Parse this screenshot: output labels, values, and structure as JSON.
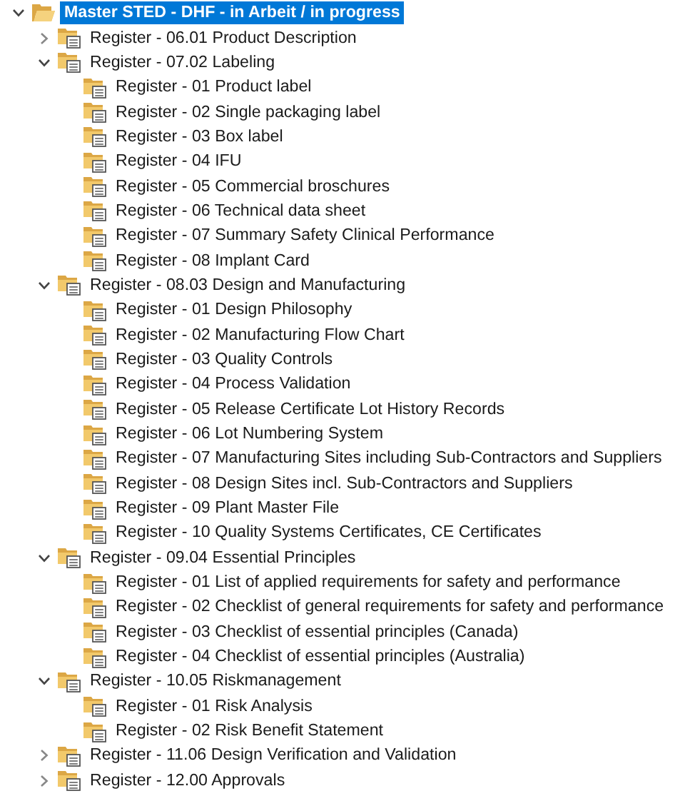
{
  "tree": [
    {
      "label": "Master STED - DHF - in Arbeit / in progress",
      "kind": "folder",
      "selected": true,
      "expanded": true,
      "children": [
        {
          "label": "Register - 06.01 Product Description",
          "kind": "register",
          "selected": false,
          "expanded": false
        },
        {
          "label": "Register - 07.02 Labeling",
          "kind": "register",
          "selected": false,
          "expanded": true,
          "children": [
            {
              "label": "Register - 01 Product label",
              "kind": "register",
              "selected": false
            },
            {
              "label": "Register - 02 Single packaging label",
              "kind": "register",
              "selected": false
            },
            {
              "label": "Register - 03 Box label",
              "kind": "register",
              "selected": false
            },
            {
              "label": "Register - 04 IFU",
              "kind": "register",
              "selected": false
            },
            {
              "label": "Register - 05 Commercial broschures",
              "kind": "register",
              "selected": false
            },
            {
              "label": "Register - 06 Technical data sheet",
              "kind": "register",
              "selected": false
            },
            {
              "label": "Register - 07 Summary Safety Clinical Performance",
              "kind": "register",
              "selected": false
            },
            {
              "label": "Register - 08 Implant Card",
              "kind": "register",
              "selected": false
            }
          ]
        },
        {
          "label": "Register - 08.03 Design and Manufacturing",
          "kind": "register",
          "selected": false,
          "expanded": true,
          "children": [
            {
              "label": "Register - 01 Design Philosophy",
              "kind": "register",
              "selected": false
            },
            {
              "label": "Register - 02 Manufacturing Flow Chart",
              "kind": "register",
              "selected": false
            },
            {
              "label": "Register - 03 Quality Controls",
              "kind": "register",
              "selected": false
            },
            {
              "label": "Register - 04 Process Validation",
              "kind": "register",
              "selected": false
            },
            {
              "label": "Register - 05 Release Certificate Lot History Records",
              "kind": "register",
              "selected": false
            },
            {
              "label": "Register - 06 Lot Numbering System",
              "kind": "register",
              "selected": false
            },
            {
              "label": "Register - 07 Manufacturing Sites including Sub-Contractors and Suppliers",
              "kind": "register",
              "selected": false
            },
            {
              "label": "Register - 08 Design Sites incl. Sub-Contractors and Suppliers",
              "kind": "register",
              "selected": false
            },
            {
              "label": "Register - 09 Plant Master File",
              "kind": "register",
              "selected": false
            },
            {
              "label": "Register - 10 Quality Systems Certificates, CE Certificates",
              "kind": "register",
              "selected": false
            }
          ]
        },
        {
          "label": "Register - 09.04 Essential Principles",
          "kind": "register",
          "selected": false,
          "expanded": true,
          "children": [
            {
              "label": "Register - 01 List of applied requirements for safety and performance",
              "kind": "register",
              "selected": false
            },
            {
              "label": "Register - 02 Checklist of general requirements for safety and performance",
              "kind": "register",
              "selected": false
            },
            {
              "label": "Register - 03 Checklist of essential principles (Canada)",
              "kind": "register",
              "selected": false
            },
            {
              "label": "Register - 04 Checklist of essential principles (Australia)",
              "kind": "register",
              "selected": false
            }
          ]
        },
        {
          "label": "Register - 10.05 Riskmanagement",
          "kind": "register",
          "selected": false,
          "expanded": true,
          "children": [
            {
              "label": "Register - 01 Risk Analysis",
              "kind": "register",
              "selected": false
            },
            {
              "label": "Register - 02 Risk Benefit Statement",
              "kind": "register",
              "selected": false
            }
          ]
        },
        {
          "label": "Register - 11.06 Design Verification and Validation",
          "kind": "register",
          "selected": false,
          "expanded": false
        },
        {
          "label": "Register - 12.00 Approvals",
          "kind": "register",
          "selected": false,
          "expanded": false
        }
      ]
    }
  ]
}
